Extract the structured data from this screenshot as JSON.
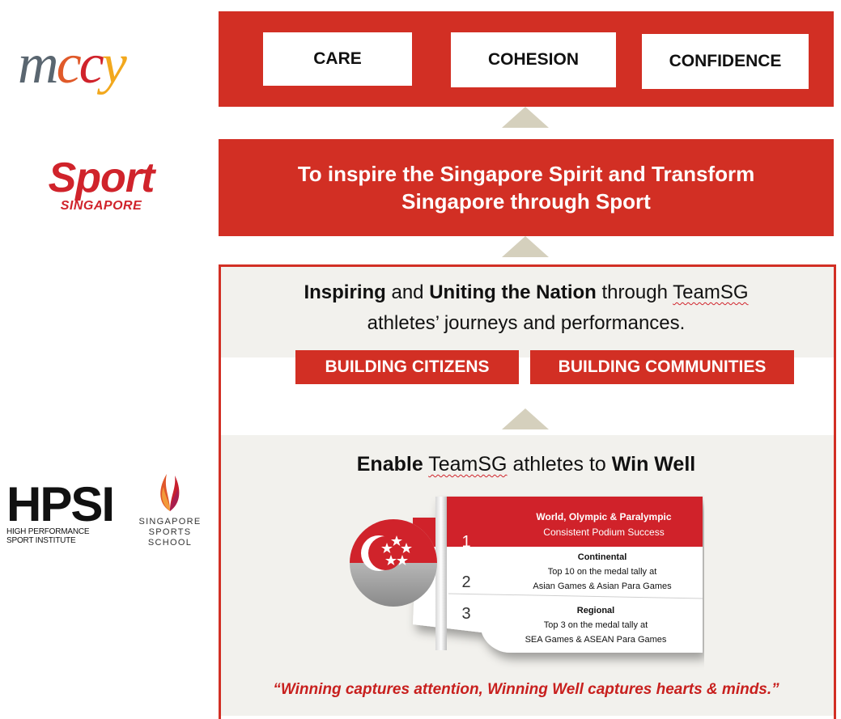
{
  "logos": {
    "mccy": {
      "letters": [
        "m",
        "c",
        "c",
        "y"
      ]
    },
    "sport": {
      "word": "Sport",
      "sub": "SINGAPORE"
    },
    "hpsi": {
      "word": "HPSI",
      "sub_line1": "HIGH PERFORMANCE",
      "sub_line2": "SPORT INSTITUTE"
    },
    "sss": {
      "sub_line1": "SINGAPORE",
      "sub_line2": "SPORTS SCHOOL"
    }
  },
  "values": [
    "CARE",
    "COHESION",
    "CONFIDENCE"
  ],
  "mission": "To inspire the Singapore Spirit and Transform Singapore through Sport",
  "statement": {
    "w1": "Inspiring",
    "w2": " and ",
    "w3": "Uniting the Nation",
    "w4": " through ",
    "w5": "TeamSG",
    "line2": "athletes’ journeys and performances."
  },
  "pillars": [
    "BUILDING CITIZENS",
    "BUILDING COMMUNITIES"
  ],
  "enable": {
    "w1": "Enable",
    "w2": " ",
    "w3": "TeamSG",
    "w4": " athletes to ",
    "w5": "Win Well"
  },
  "tiers": [
    {
      "rank": "1",
      "title": "World, Olympic & Paralympic",
      "line1": "Consistent Podium Success",
      "line2": ""
    },
    {
      "rank": "2",
      "title": "Continental",
      "line1": "Top 10 on the medal tally at",
      "line2": "Asian Games & Asian Para Games"
    },
    {
      "rank": "3",
      "title": "Regional",
      "line1": "Top 3 on the medal tally at",
      "line2": "SEA Games & ASEAN Para Games"
    }
  ],
  "quote": "“Winning captures attention, Winning Well captures hearts & minds.”",
  "colors": {
    "red": "#d22f24",
    "arrow": "#d5d0bd",
    "panel_bg": "#f2f1ed",
    "quote": "#c8201e"
  }
}
